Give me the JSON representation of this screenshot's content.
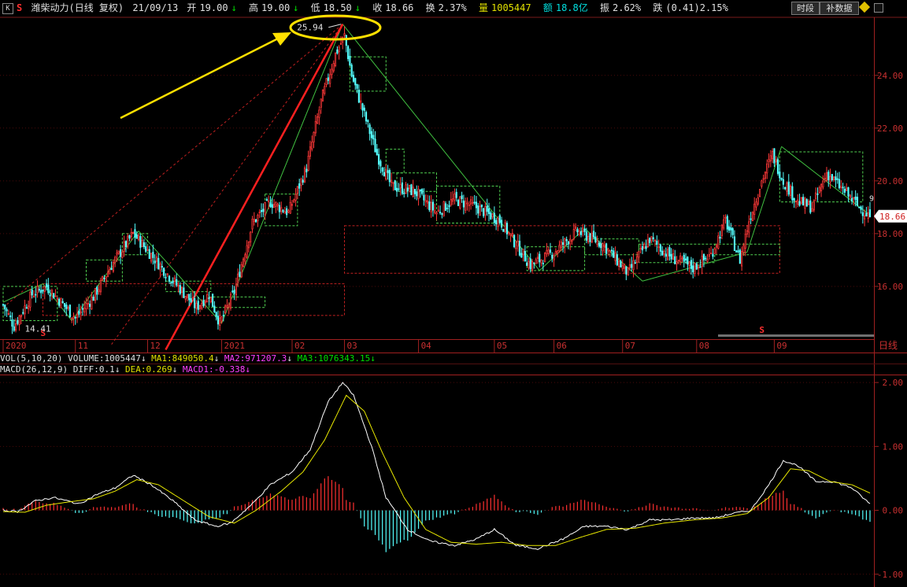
{
  "header": {
    "k_label": "K",
    "s_label": "S",
    "name": "潍柴动力(日线 复权)",
    "date": "21/09/13",
    "open_label": "开",
    "open": "19.00",
    "high_label": "高",
    "high": "19.00",
    "low_label": "低",
    "low": "18.50",
    "close_label": "收",
    "close": "18.66",
    "turnover_label": "换",
    "turnover": "2.37%",
    "volume_label": "量",
    "volume": "1005447",
    "amount_label": "额",
    "amount": "18.8亿",
    "amplitude_label": "振",
    "amplitude": "2.62%",
    "change_label": "跌",
    "change": "(0.41)2.15%",
    "btn_timeshare": "时段",
    "btn_supplement": "补数据"
  },
  "chart_data": [
    {
      "type": "candlestick",
      "name": "price",
      "y_ticks": [
        "24.00",
        "22.00",
        "20.00",
        "18.00",
        "16.00"
      ],
      "ylim": [
        14.0,
        26.2
      ],
      "x_labels": [
        "2020",
        "11",
        "12",
        "2021",
        "02",
        "03",
        "04",
        "05",
        "06",
        "07",
        "08",
        "09"
      ],
      "x_axis_right_label": "日线",
      "current_price": "18.66",
      "high_annotation": "25.94",
      "low_annotation": "14.41",
      "edge_digit": "9",
      "s_markers": [
        "S",
        "S"
      ],
      "close_anchors": [
        [
          0,
          15.3
        ],
        [
          6,
          14.5
        ],
        [
          16,
          15.7
        ],
        [
          24,
          16.0
        ],
        [
          40,
          14.8
        ],
        [
          50,
          15.6
        ],
        [
          60,
          16.8
        ],
        [
          72,
          18.0
        ],
        [
          82,
          17.2
        ],
        [
          93,
          16.3
        ],
        [
          107,
          15.2
        ],
        [
          114,
          15.7
        ],
        [
          120,
          14.6
        ],
        [
          128,
          15.8
        ],
        [
          138,
          18.4
        ],
        [
          148,
          19.2
        ],
        [
          158,
          18.8
        ],
        [
          168,
          20.5
        ],
        [
          176,
          23.0
        ],
        [
          184,
          24.8
        ],
        [
          189,
          25.5
        ],
        [
          193,
          24.0
        ],
        [
          200,
          22.5
        ],
        [
          207,
          21.0
        ],
        [
          215,
          19.8
        ],
        [
          228,
          19.6
        ],
        [
          240,
          18.8
        ],
        [
          250,
          19.3
        ],
        [
          262,
          19.0
        ],
        [
          275,
          18.5
        ],
        [
          292,
          16.8
        ],
        [
          305,
          17.3
        ],
        [
          318,
          18.1
        ],
        [
          332,
          17.6
        ],
        [
          346,
          16.5
        ],
        [
          358,
          17.8
        ],
        [
          370,
          17.1
        ],
        [
          382,
          16.7
        ],
        [
          392,
          17.2
        ],
        [
          400,
          18.5
        ],
        [
          408,
          17.0
        ],
        [
          413,
          18.5
        ],
        [
          420,
          20.0
        ],
        [
          426,
          21.0
        ],
        [
          432,
          20.0
        ],
        [
          440,
          19.2
        ],
        [
          448,
          19.0
        ],
        [
          456,
          20.3
        ],
        [
          466,
          19.6
        ],
        [
          474,
          19.0
        ],
        [
          480,
          18.66
        ]
      ],
      "zigzag_points": [
        [
          0,
          15.4
        ],
        [
          22,
          16.1
        ],
        [
          38,
          14.7
        ],
        [
          75,
          18.1
        ],
        [
          121,
          14.6
        ],
        [
          188,
          25.94
        ],
        [
          297,
          16.6
        ],
        [
          322,
          18.2
        ],
        [
          354,
          16.2
        ],
        [
          412,
          17.3
        ],
        [
          431,
          21.3
        ],
        [
          480,
          18.7
        ]
      ]
    },
    {
      "type": "bar",
      "name": "VOL",
      "series": [
        {
          "name": "VOLUME",
          "value": "1005447"
        },
        {
          "name": "MA1",
          "value": "849050.4"
        },
        {
          "name": "MA2",
          "value": "971207.3"
        },
        {
          "name": "MA3",
          "value": "1076343.15"
        }
      ],
      "params": "VOL(5,10,20)"
    },
    {
      "type": "line",
      "name": "MACD",
      "params": "MACD(26,12,9)",
      "series": [
        {
          "name": "DIFF",
          "value": "0.1"
        },
        {
          "name": "DEA",
          "value": "0.269"
        },
        {
          "name": "MACD1",
          "value": "-0.338"
        }
      ],
      "y_ticks": [
        "2.00",
        "1.00",
        "0.00",
        "-1.00"
      ],
      "ylim": [
        -1.2,
        2.1
      ],
      "diff_anchors": [
        [
          0,
          0.0
        ],
        [
          8,
          -0.02
        ],
        [
          18,
          0.15
        ],
        [
          28,
          0.2
        ],
        [
          42,
          0.1
        ],
        [
          52,
          0.25
        ],
        [
          62,
          0.35
        ],
        [
          72,
          0.55
        ],
        [
          82,
          0.4
        ],
        [
          94,
          0.15
        ],
        [
          106,
          -0.15
        ],
        [
          118,
          -0.25
        ],
        [
          126,
          -0.2
        ],
        [
          138,
          0.1
        ],
        [
          148,
          0.4
        ],
        [
          160,
          0.6
        ],
        [
          170,
          0.95
        ],
        [
          180,
          1.7
        ],
        [
          188,
          2.0
        ],
        [
          194,
          1.8
        ],
        [
          204,
          1.0
        ],
        [
          212,
          0.2
        ],
        [
          224,
          -0.3
        ],
        [
          236,
          -0.48
        ],
        [
          250,
          -0.55
        ],
        [
          262,
          -0.45
        ],
        [
          272,
          -0.3
        ],
        [
          284,
          -0.55
        ],
        [
          296,
          -0.6
        ],
        [
          310,
          -0.45
        ],
        [
          322,
          -0.25
        ],
        [
          334,
          -0.25
        ],
        [
          346,
          -0.3
        ],
        [
          358,
          -0.15
        ],
        [
          370,
          -0.15
        ],
        [
          382,
          -0.12
        ],
        [
          394,
          -0.12
        ],
        [
          404,
          -0.05
        ],
        [
          414,
          0.0
        ],
        [
          424,
          0.4
        ],
        [
          432,
          0.78
        ],
        [
          440,
          0.7
        ],
        [
          450,
          0.45
        ],
        [
          460,
          0.45
        ],
        [
          470,
          0.35
        ],
        [
          480,
          0.1
        ]
      ],
      "dea_anchors": [
        [
          0,
          -0.02
        ],
        [
          12,
          -0.03
        ],
        [
          24,
          0.08
        ],
        [
          36,
          0.13
        ],
        [
          50,
          0.18
        ],
        [
          62,
          0.3
        ],
        [
          74,
          0.48
        ],
        [
          86,
          0.4
        ],
        [
          100,
          0.15
        ],
        [
          114,
          -0.1
        ],
        [
          128,
          -0.2
        ],
        [
          140,
          0.0
        ],
        [
          154,
          0.3
        ],
        [
          166,
          0.6
        ],
        [
          178,
          1.1
        ],
        [
          190,
          1.8
        ],
        [
          200,
          1.55
        ],
        [
          210,
          0.9
        ],
        [
          222,
          0.2
        ],
        [
          234,
          -0.3
        ],
        [
          248,
          -0.5
        ],
        [
          262,
          -0.53
        ],
        [
          276,
          -0.5
        ],
        [
          290,
          -0.55
        ],
        [
          306,
          -0.55
        ],
        [
          320,
          -0.42
        ],
        [
          334,
          -0.3
        ],
        [
          350,
          -0.28
        ],
        [
          366,
          -0.2
        ],
        [
          382,
          -0.15
        ],
        [
          398,
          -0.12
        ],
        [
          412,
          -0.05
        ],
        [
          424,
          0.2
        ],
        [
          436,
          0.65
        ],
        [
          446,
          0.62
        ],
        [
          458,
          0.45
        ],
        [
          470,
          0.4
        ],
        [
          480,
          0.27
        ]
      ]
    }
  ]
}
